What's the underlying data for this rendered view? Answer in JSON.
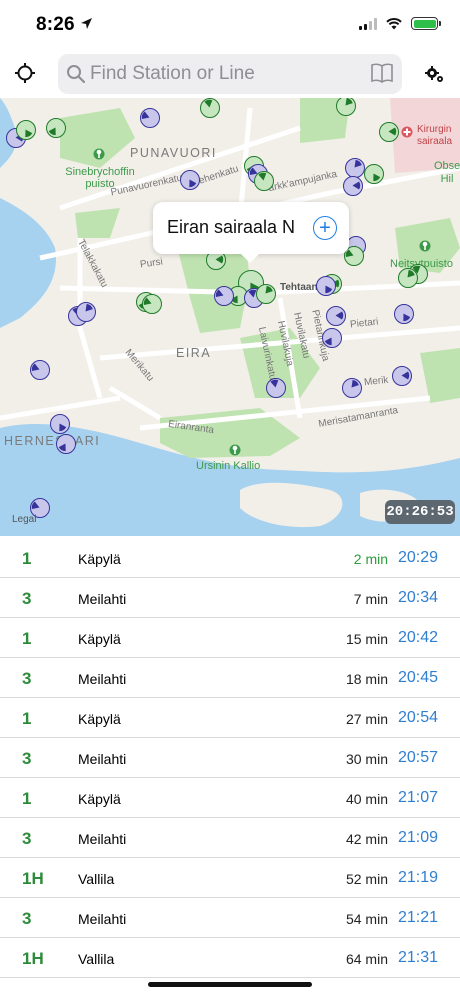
{
  "status_bar": {
    "time": "8:26",
    "battery_color": "#2fc04a"
  },
  "search": {
    "placeholder": "Find Station or Line",
    "value": ""
  },
  "icons": {
    "locate": "crosshair-icon",
    "search": "magnifier-icon",
    "bookmarks": "book-icon",
    "settings": "gear-icon"
  },
  "map": {
    "labels": {
      "punavuori": "PUNAVUORI",
      "eira": "EIRA",
      "hernesaari": "HERNESAARI",
      "sinebrychoffin": "Sinebrychoffin puisto",
      "neitsytpuisto": "Neitsytpuisto",
      "ursinin": "Ursinin Kallio",
      "kirurginen": "Kirurgin sairaala",
      "observatorio": "Obse Hil",
      "punavuorenkatu": "Punavuorenkatu",
      "telakkakatu": "Telakkakatu",
      "tehtaankatu": "Tehtaan",
      "merikatu": "Merikatu",
      "eiranranta": "Eiranranta",
      "merisatamanranta": "Merisatamanranta",
      "laivurinkatu": "Laivurinkatu",
      "huvilakuja": "Huvilakuja",
      "huvilakatu": "Huvilakatu",
      "pietarinkuja": "Pietarinkuja",
      "pursimiehenkatu": "Pursi",
      "merimiehenkatu": "iehenkatu",
      "kapteeninkatu": "arkk'ampujanka",
      "pietarinkatu": "Pietari",
      "merikatu_east": "Merik"
    },
    "callout_title": "Eiran sairaala N",
    "legal": "Legal",
    "clock": "20:26:53"
  },
  "departures": [
    {
      "line": "1",
      "destination": "Käpylä",
      "minutes": "2 min",
      "time": "20:29",
      "soon": true
    },
    {
      "line": "3",
      "destination": "Meilahti",
      "minutes": "7 min",
      "time": "20:34",
      "soon": false
    },
    {
      "line": "1",
      "destination": "Käpylä",
      "minutes": "15 min",
      "time": "20:42",
      "soon": false
    },
    {
      "line": "3",
      "destination": "Meilahti",
      "minutes": "18 min",
      "time": "20:45",
      "soon": false
    },
    {
      "line": "1",
      "destination": "Käpylä",
      "minutes": "27 min",
      "time": "20:54",
      "soon": false
    },
    {
      "line": "3",
      "destination": "Meilahti",
      "minutes": "30 min",
      "time": "20:57",
      "soon": false
    },
    {
      "line": "1",
      "destination": "Käpylä",
      "minutes": "40 min",
      "time": "21:07",
      "soon": false
    },
    {
      "line": "3",
      "destination": "Meilahti",
      "minutes": "42 min",
      "time": "21:09",
      "soon": false
    },
    {
      "line": "1H",
      "destination": "Vallila",
      "minutes": "52 min",
      "time": "21:19",
      "soon": false
    },
    {
      "line": "3",
      "destination": "Meilahti",
      "minutes": "54 min",
      "time": "21:21",
      "soon": false
    },
    {
      "line": "1H",
      "destination": "Vallila",
      "minutes": "64 min",
      "time": "21:31",
      "soon": false
    }
  ],
  "colors": {
    "line_green": "#2e8b3a",
    "time_blue": "#2f7fd0",
    "bus_marker": "#36349a",
    "tram_marker": "#1f7a2a",
    "water": "#a6d2f0",
    "park": "#bfe3b0"
  }
}
